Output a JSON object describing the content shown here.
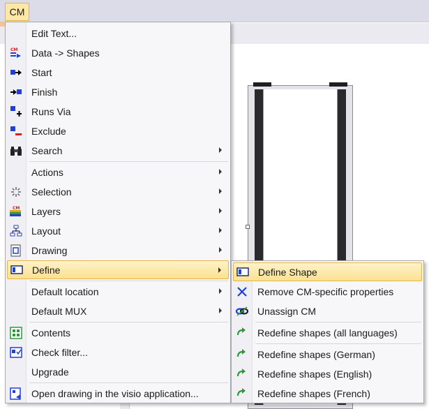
{
  "menubar": {
    "cm_label": "CM"
  },
  "main_menu": {
    "items": [
      {
        "label": "Edit Text...",
        "icon": "none"
      },
      {
        "label": "Data -> Shapes",
        "icon": "cm-data-shapes-icon"
      },
      {
        "label": "Start",
        "icon": "start-icon"
      },
      {
        "label": "Finish",
        "icon": "finish-icon"
      },
      {
        "label": "Runs Via",
        "icon": "runs-via-icon"
      },
      {
        "label": "Exclude",
        "icon": "exclude-icon"
      },
      {
        "label": "Search",
        "icon": "binoculars-icon"
      },
      {
        "label": "Actions",
        "icon": "none"
      },
      {
        "label": "Selection",
        "icon": "selection-icon"
      },
      {
        "label": "Layers",
        "icon": "cm-layers-icon"
      },
      {
        "label": "Layout",
        "icon": "layout-icon"
      },
      {
        "label": "Drawing",
        "icon": "drawing-icon"
      },
      {
        "label": "Define",
        "icon": "define-icon"
      },
      {
        "label": "Default location",
        "icon": "none"
      },
      {
        "label": "Default MUX",
        "icon": "none"
      },
      {
        "label": "Contents",
        "icon": "contents-icon"
      },
      {
        "label": "Check filter...",
        "icon": "check-filter-icon"
      },
      {
        "label": "Upgrade",
        "icon": "none"
      },
      {
        "label": "Open drawing in the visio application...",
        "icon": "open-drawing-icon"
      }
    ]
  },
  "sub_menu": {
    "items": [
      {
        "label": "Define Shape",
        "icon": "define-shape-icon"
      },
      {
        "label": "Remove CM-specific properties",
        "icon": "remove-x-icon"
      },
      {
        "label": "Unassign CM",
        "icon": "unassign-icon"
      },
      {
        "label": "Redefine shapes (all languages)",
        "icon": "redefine-icon"
      },
      {
        "label": "Redefine shapes (German)",
        "icon": "redefine-icon"
      },
      {
        "label": "Redefine shapes (English)",
        "icon": "redefine-icon"
      },
      {
        "label": "Redefine shapes (French)",
        "icon": "redefine-icon"
      }
    ]
  },
  "colors": {
    "highlight": "#fbe193",
    "highlight_border": "#e3b64c",
    "menubar": "#dcdce8",
    "icon_blue": "#1f3fd6",
    "icon_red": "#d42020",
    "icon_green": "#2a9a3a"
  }
}
